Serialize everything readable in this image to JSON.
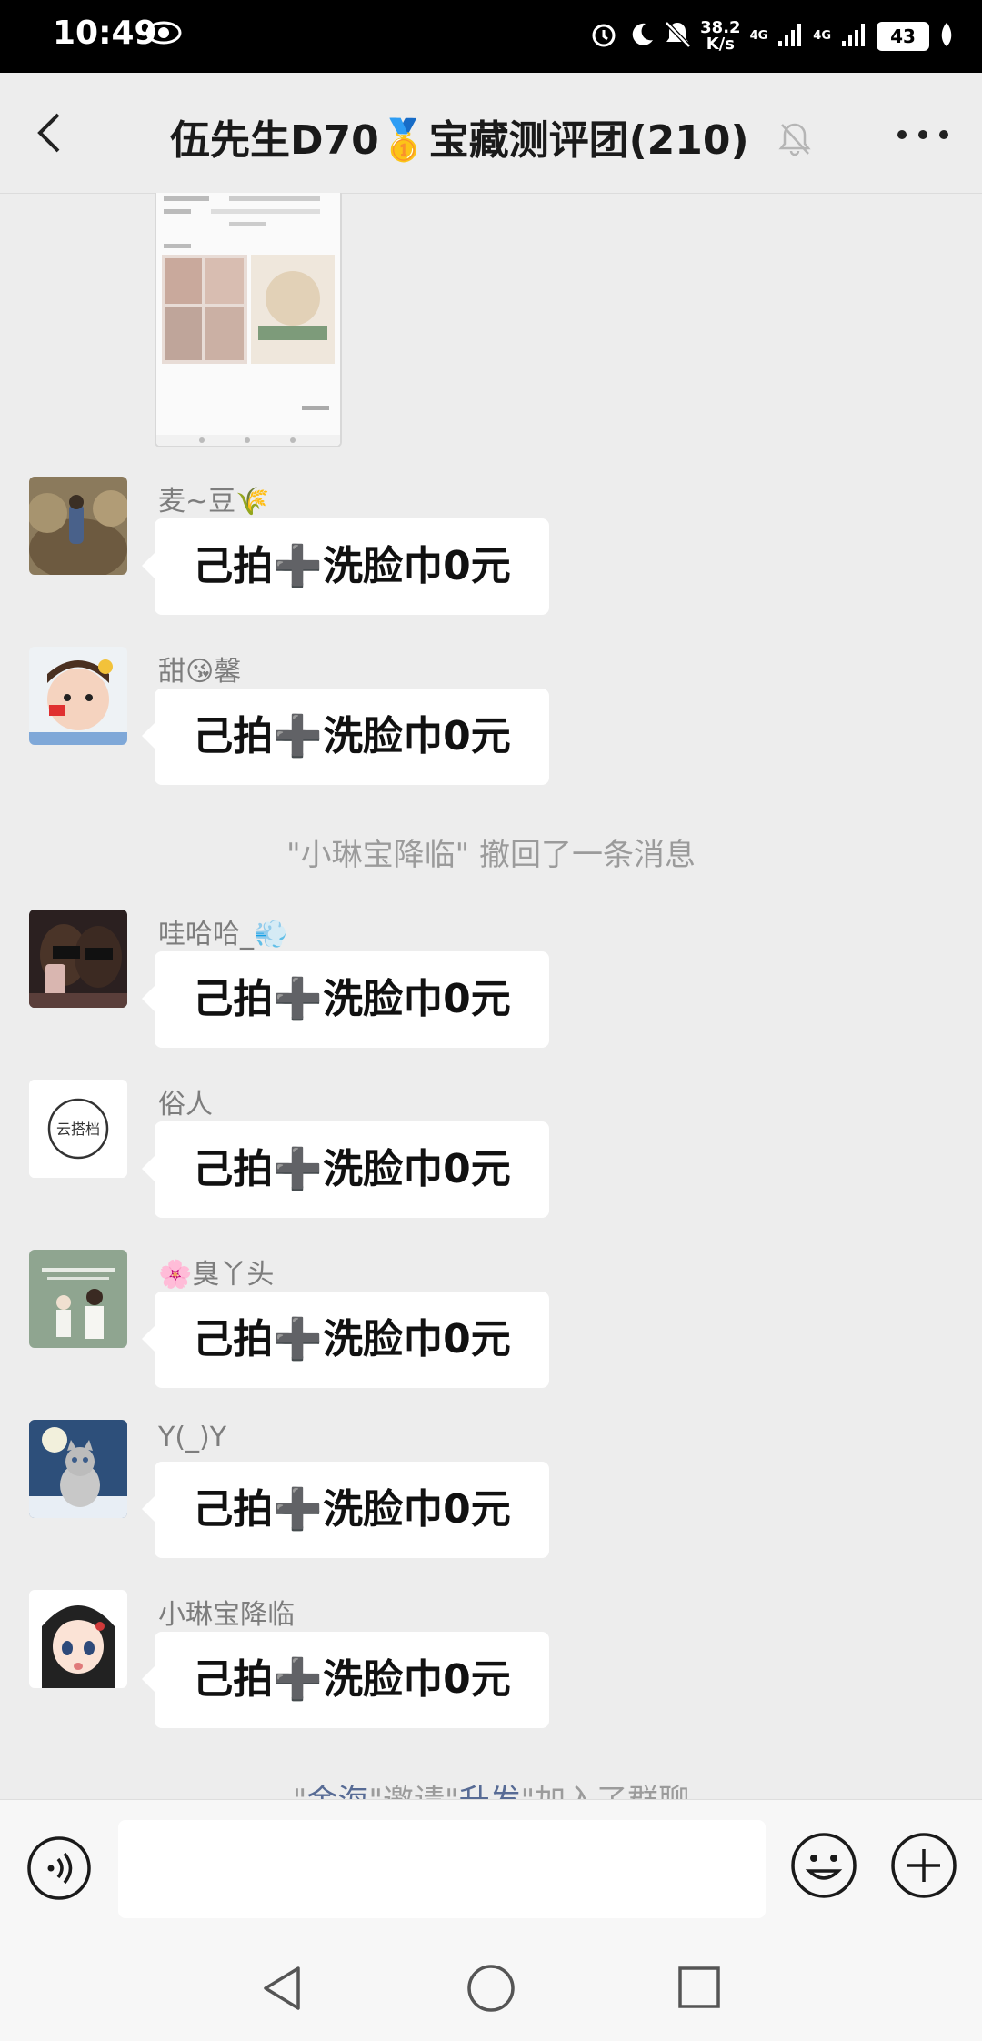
{
  "status_bar": {
    "time": "10:49",
    "speed_value": "38.2",
    "speed_unit": "K/s",
    "network_1": "4G",
    "network_2": "4G",
    "battery": "43"
  },
  "header": {
    "title_prefix": "伍先生D70",
    "title_medal": "🥇",
    "title_suffix": "宝藏测评团(210)",
    "back_icon": "chevron-left-icon",
    "mute_icon": "bell-off-icon",
    "more_icon": "more-dots-icon"
  },
  "messages": [
    {
      "nickname": "麦~豆🌾",
      "text": "己拍➕洗脸巾0元"
    },
    {
      "nickname": "甜😘馨",
      "text": "己拍➕洗脸巾0元"
    },
    {
      "nickname": "哇哈哈_💨",
      "text": "己拍➕洗脸巾0元"
    },
    {
      "nickname": "俗人",
      "text": "己拍➕洗脸巾0元"
    },
    {
      "nickname": "🌸臭丫头",
      "text": "己拍➕洗脸巾0元"
    },
    {
      "nickname": "Y(_)Y",
      "text": "己拍➕洗脸巾0元"
    },
    {
      "nickname": "小琳宝降临",
      "text": "己拍➕洗脸巾0元"
    }
  ],
  "system_notes": {
    "recall": "\"小琳宝降临\" 撤回了一条消息",
    "invite_q1": "\"",
    "invite_inviter": "金海",
    "invite_q2": "\"邀请\"",
    "invite_invitee": "升发",
    "invite_tail": "\"加入了群聊"
  },
  "avatar_logo_text": "云搭档",
  "input_bar": {
    "voice_icon": "voice-icon",
    "placeholder": "",
    "emoji_icon": "emoji-icon",
    "plus_icon": "plus-circle-icon"
  },
  "nav_bar": {
    "back_icon": "triangle-back-icon",
    "home_icon": "circle-home-icon",
    "recent_icon": "square-recent-icon"
  },
  "colors": {
    "chat_background": "#ededed",
    "bubble": "#ffffff",
    "nickname": "#7d7d7d",
    "system_text": "#9b9b9b",
    "link_name": "#576b95"
  }
}
